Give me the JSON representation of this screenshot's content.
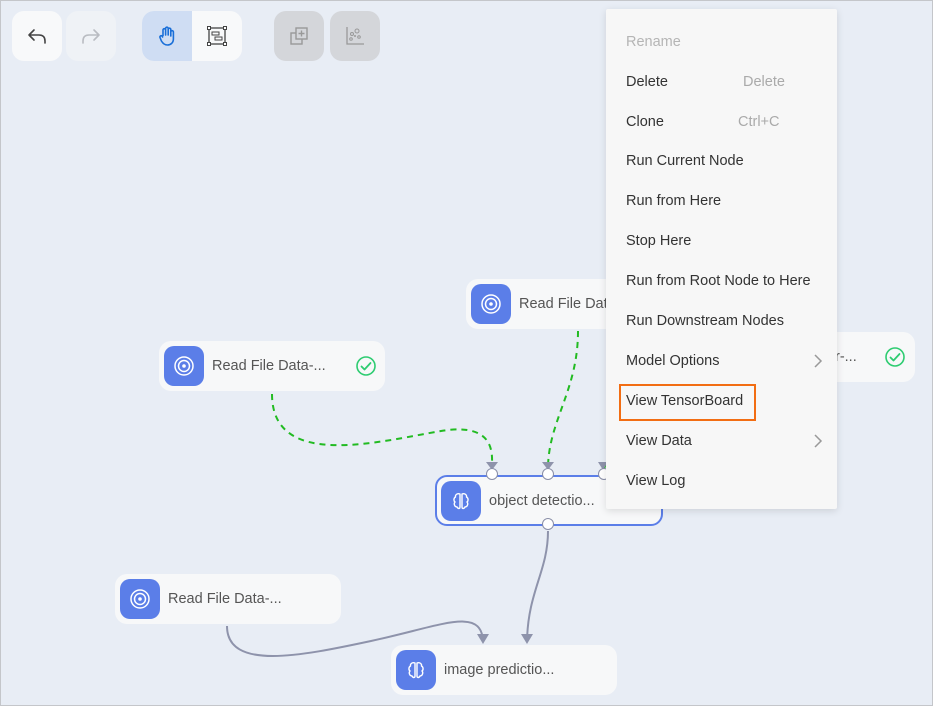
{
  "toolbar": {
    "undo": {
      "icon": "undo-icon",
      "enabled": true
    },
    "redo": {
      "icon": "redo-icon",
      "enabled": false
    },
    "mode_group": [
      {
        "icon": "hand-pan-icon",
        "active": true
      },
      {
        "icon": "box-select-icon",
        "active": false
      }
    ],
    "add_group": {
      "icon": "add-group-icon",
      "enabled": false
    },
    "scatter": {
      "icon": "scatter-plot-icon",
      "enabled": false
    }
  },
  "nodes": [
    {
      "id": "read1",
      "label": "Read File Data-...",
      "icon": "target-icon",
      "status": "success"
    },
    {
      "id": "read2",
      "label": "Read File Dat",
      "icon": "target-icon",
      "status": null
    },
    {
      "id": "read3",
      "label": "r-...",
      "icon": "target-icon",
      "status": "success"
    },
    {
      "id": "objdet",
      "label": "object detectio...",
      "icon": "brain-icon",
      "status": null,
      "selected": true
    },
    {
      "id": "read4",
      "label": "Read File Data-...",
      "icon": "target-icon",
      "status": null
    },
    {
      "id": "imgpred",
      "label": "image predictio...",
      "icon": "brain-icon",
      "status": null
    }
  ],
  "edges": [
    {
      "from": "read1",
      "to": "objdet",
      "style": "dashed",
      "color": "#22bb22"
    },
    {
      "from": "read2",
      "to": "objdet",
      "style": "dashed",
      "color": "#22bb22"
    },
    {
      "from": "read3",
      "to": "objdet",
      "style": "dashed",
      "color": "#22bb22"
    },
    {
      "from": "objdet",
      "to": "imgpred",
      "style": "solid",
      "color": "#8e93ab"
    },
    {
      "from": "read4",
      "to": "imgpred",
      "style": "solid",
      "color": "#8e93ab"
    }
  ],
  "context_menu": {
    "items": [
      {
        "label": "Rename",
        "disabled": true
      },
      {
        "label": "Delete",
        "shortcut": "Delete"
      },
      {
        "label": "Clone",
        "shortcut": "Ctrl+C"
      },
      {
        "label": "Run Current Node"
      },
      {
        "label": "Run from Here"
      },
      {
        "label": "Stop Here"
      },
      {
        "label": "Run from Root Node to Here"
      },
      {
        "label": "Run Downstream Nodes"
      },
      {
        "label": "Model Options",
        "submenu": true
      },
      {
        "label": "View TensorBoard",
        "highlighted": true
      },
      {
        "label": "View Data",
        "submenu": true
      },
      {
        "label": "View Log"
      }
    ]
  },
  "colors": {
    "accent": "#5b7ee8",
    "success": "#2ecc71",
    "highlight": "#f26d13",
    "edge_running": "#22bb22",
    "edge_default": "#8e93ab"
  }
}
